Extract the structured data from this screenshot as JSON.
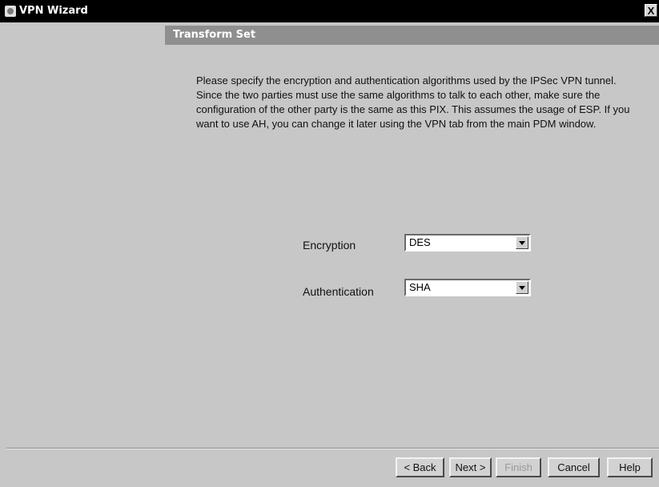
{
  "window": {
    "title": "VPN Wizard",
    "close_label": "X"
  },
  "header": {
    "title": "Transform Set"
  },
  "description": "Please specify the encryption and authentication algorithms used by the IPSec VPN tunnel.  Since the two parties must use the same algorithms to talk to each other, make sure the configuration of the other party is the same as this PIX. This assumes the usage of ESP.  If you want to use AH, you can change it later using the VPN tab from the main PDM window.",
  "form": {
    "encryption": {
      "label": "Encryption",
      "value": "DES"
    },
    "authentication": {
      "label": "Authentication",
      "value": "SHA"
    }
  },
  "buttons": {
    "back": "< Back",
    "next": "Next >",
    "finish": "Finish",
    "cancel": "Cancel",
    "help": "Help"
  },
  "icons": {
    "app": "vpn-wizard-icon",
    "close": "close-icon",
    "dropdown": "chevron-down-icon"
  }
}
